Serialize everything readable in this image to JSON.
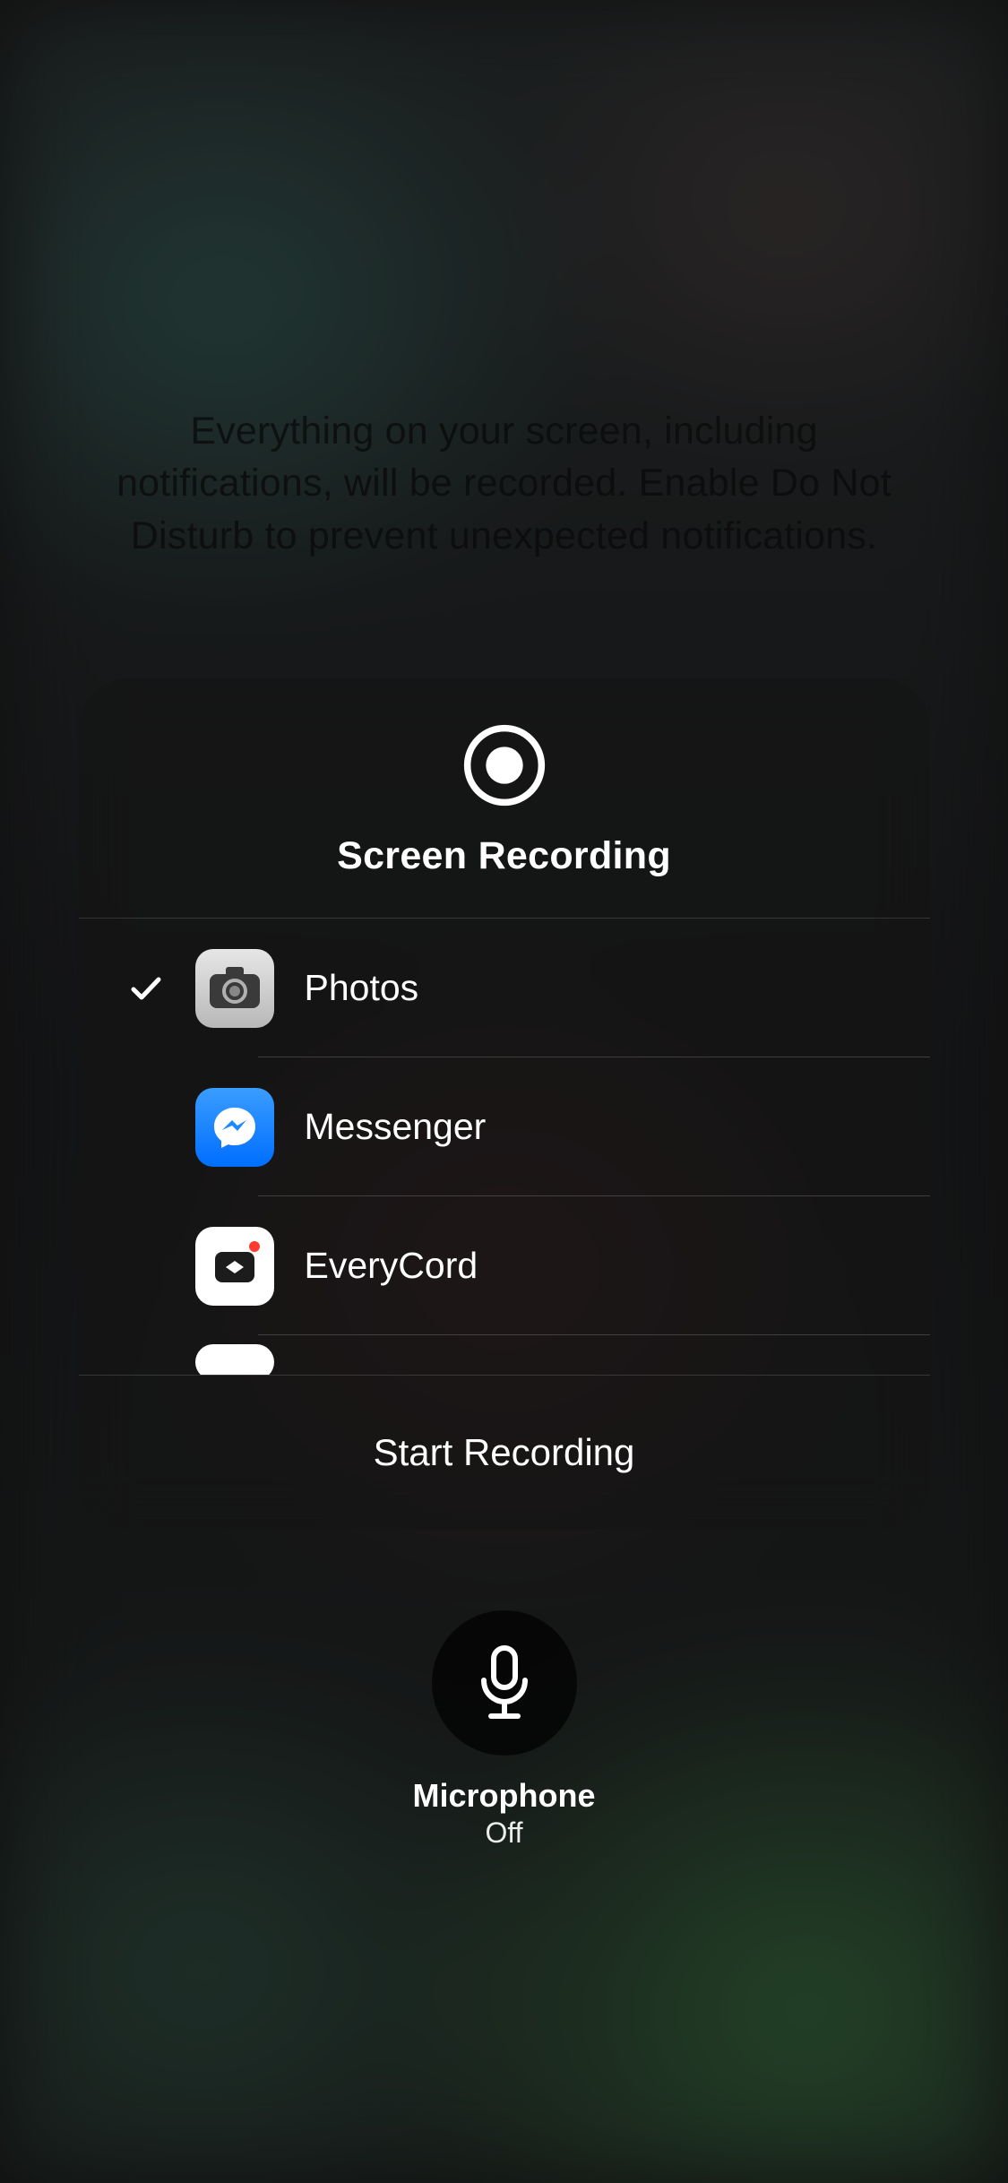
{
  "info_text": "Everything on your screen, including notifications, will be recorded. Enable Do Not Disturb to prevent unexpected notifications.",
  "panel": {
    "title": "Screen Recording",
    "apps": [
      {
        "name": "Photos",
        "selected": true,
        "icon": "photos-icon"
      },
      {
        "name": "Messenger",
        "selected": false,
        "icon": "messenger-icon"
      },
      {
        "name": "EveryCord",
        "selected": false,
        "icon": "everycord-icon"
      }
    ],
    "start_label": "Start Recording"
  },
  "microphone": {
    "label": "Microphone",
    "state": "Off"
  }
}
